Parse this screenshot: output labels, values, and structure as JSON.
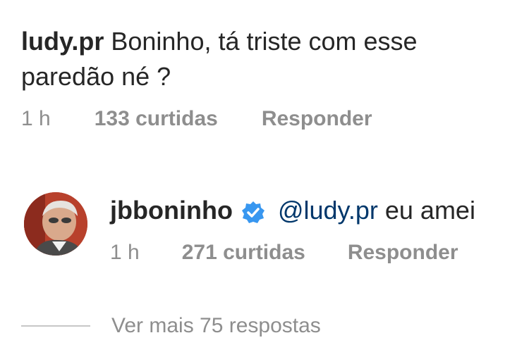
{
  "comment": {
    "username": "ludy.pr",
    "text_line1": "Boninho, tá triste com esse",
    "text_line2": "paredão né ?",
    "time": "1 h",
    "likes": "133 curtidas",
    "reply_label": "Responder"
  },
  "reply": {
    "avatar": "user-avatar",
    "username": "jbboninho",
    "verified_badge": "verified-badge-icon",
    "mention": "@ludy.pr",
    "text": "eu amei",
    "time": "1 h",
    "likes": "271 curtidas",
    "reply_label": "Responder"
  },
  "view_more": {
    "label": "Ver mais 75 respostas"
  },
  "colors": {
    "text": "#262626",
    "secondary": "#8e8e8e",
    "mention": "#00376b",
    "verified": "#3897f0"
  }
}
